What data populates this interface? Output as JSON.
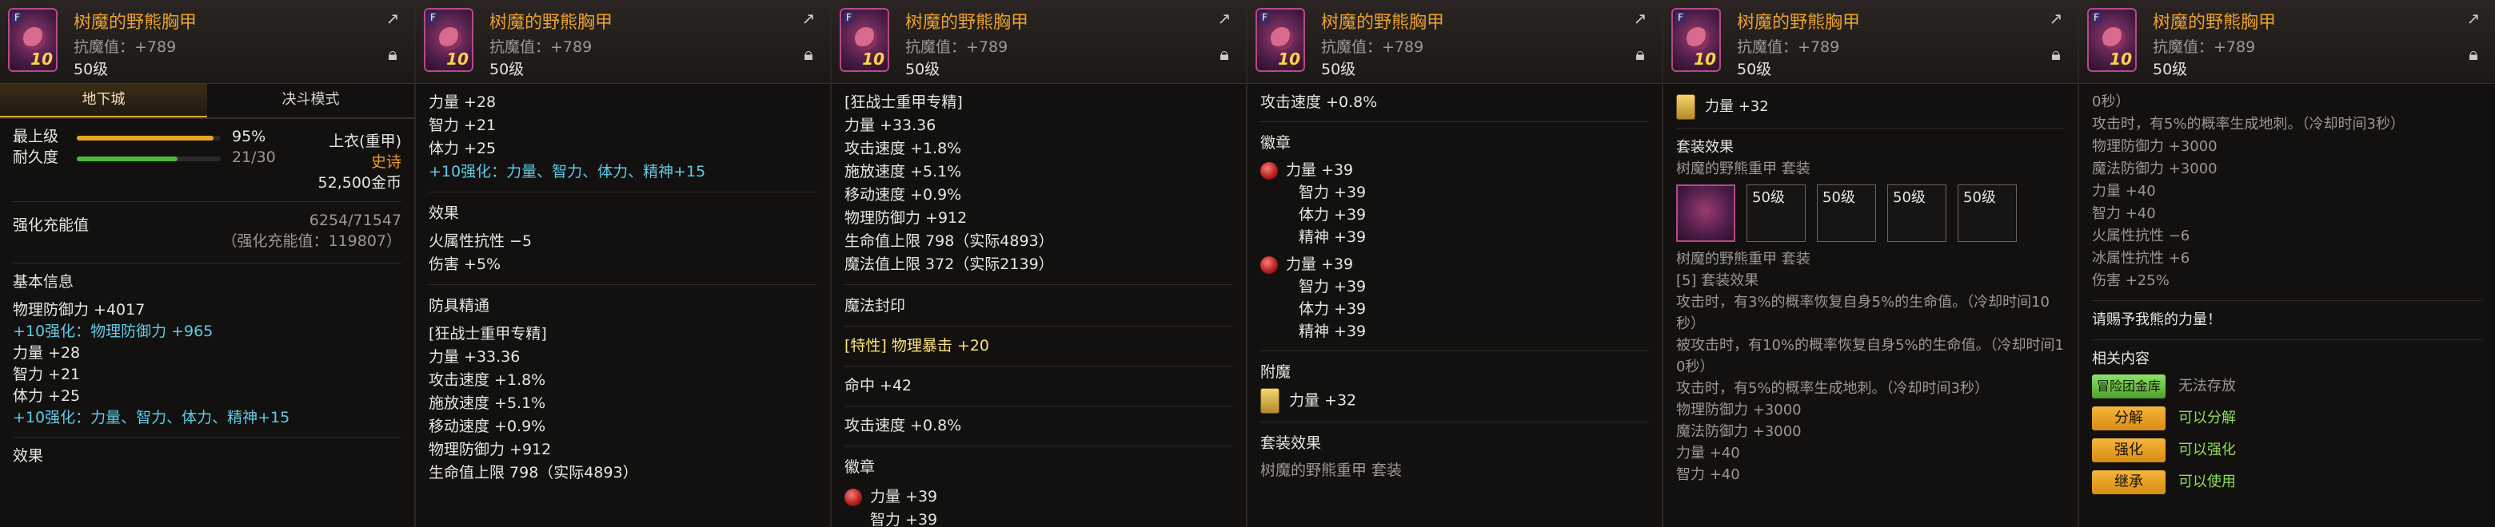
{
  "item": {
    "name": "树魔的野熊胸甲",
    "mana_line": "抗魔值：+789",
    "level": "50级",
    "icon_tag": "F",
    "icon_level": "10"
  },
  "p1": {
    "tab_left": "地下城",
    "tab_right": "决斗模式",
    "grade_label": "最上级",
    "grade_value": "95%",
    "grade_fraction": 0.95,
    "dur_label": "耐久度",
    "dur_value": "21/30",
    "dur_fraction": 0.7,
    "armor_type": "上衣(重甲)",
    "rarity": "史诗",
    "price": "52,500金币",
    "enhance_label": "强化充能值",
    "enhance_value": "6254/71547",
    "enhance_sub": "（强化充能值：119807）",
    "basic_title": "基本信息",
    "l1": "物理防御力 +4017",
    "l2": "+10强化：物理防御力 +965",
    "l3": "力量 +28",
    "l4": "智力 +21",
    "l5": "体力 +25",
    "l6": "+10强化：力量、智力、体力、精神+15",
    "effect_title": "效果"
  },
  "p2": {
    "l1": "力量 +28",
    "l2": "智力 +21",
    "l3": "体力 +25",
    "l4": "+10强化：力量、智力、体力、精神+15",
    "effect_title": "效果",
    "e1": "火属性抗性 −5",
    "e2": "伤害 +5%",
    "mastery_title": "防具精通",
    "m1": "[狂战士重甲专精]",
    "m2": "力量 +33.36",
    "m3": "攻击速度 +1.8%",
    "m4": "施放速度 +5.1%",
    "m5": "移动速度 +0.9%",
    "m6": "物理防御力 +912",
    "m7": "生命值上限 798（实际4893）"
  },
  "p3": {
    "l1": "[狂战士重甲专精]",
    "l2": "力量 +33.36",
    "l3": "攻击速度 +1.8%",
    "l4": "施放速度 +5.1%",
    "l5": "移动速度 +0.9%",
    "l6": "物理防御力 +912",
    "l7": "生命值上限 798（实际4893）",
    "l8": "魔法值上限 372（实际2139）",
    "seal_title": "魔法封印",
    "s1": "[特性] 物理暴击 +20",
    "s2": "命中 +42",
    "s3": "攻击速度 +0.8%",
    "emblem_title": "徽章",
    "b1": "力量 +39",
    "b2": "智力 +39"
  },
  "p4": {
    "l1": "攻击速度 +0.8%",
    "emblem_title": "徽章",
    "a1": "力量 +39",
    "a2": "智力 +39",
    "a3": "体力 +39",
    "a4": "精神 +39",
    "b1": "力量 +39",
    "b2": "智力 +39",
    "b3": "体力 +39",
    "b4": "精神 +39",
    "enchant_title": "附魔",
    "enchant": "力量 +32",
    "set_title": "套装效果",
    "set_name": "树魔的野熊重甲  套装"
  },
  "p5": {
    "enchant": "力量 +32",
    "set_title": "套装效果",
    "set_name": "树魔的野熊重甲  套装",
    "set_icon_label": "50级",
    "s1": "树魔的野熊重甲  套装",
    "s2": "[5] 套装效果",
    "s3": "攻击时，有3%的概率恢复自身5%的生命值。（冷却时间10",
    "s4": "秒）",
    "s5": "被攻击时，有10%的概率恢复自身5%的生命值。（冷却时间1",
    "s6": "0秒）",
    "s7": "攻击时，有5%的概率生成地刺。（冷却时间3秒）",
    "s8": "物理防御力 +3000",
    "s9": "魔法防御力 +3000",
    "s10": "力量 +40",
    "s11": "智力 +40"
  },
  "p6": {
    "l1": "0秒）",
    "l2": "攻击时，有5%的概率生成地刺。（冷却时间3秒）",
    "l3": "物理防御力 +3000",
    "l4": "魔法防御力 +3000",
    "l5": "力量 +40",
    "l6": "智力 +40",
    "l7": "火属性抗性 −6",
    "l8": "冰属性抗性 +6",
    "l9": "伤害 +25%",
    "quote": "请赐予我熊的力量！",
    "related_title": "相关内容",
    "r1_btn": "冒险团金库",
    "r1_text": "无法存放",
    "r2_btn": "分解",
    "r2_text": "可以分解",
    "r3_btn": "强化",
    "r3_text": "可以强化",
    "r4_btn": "继承",
    "r4_text": "可以使用"
  },
  "colors": {
    "title_orange": "#e8a032",
    "cyan": "#5ecbe6",
    "button_orange": "#f0a526",
    "button_green": "#7cd056"
  }
}
